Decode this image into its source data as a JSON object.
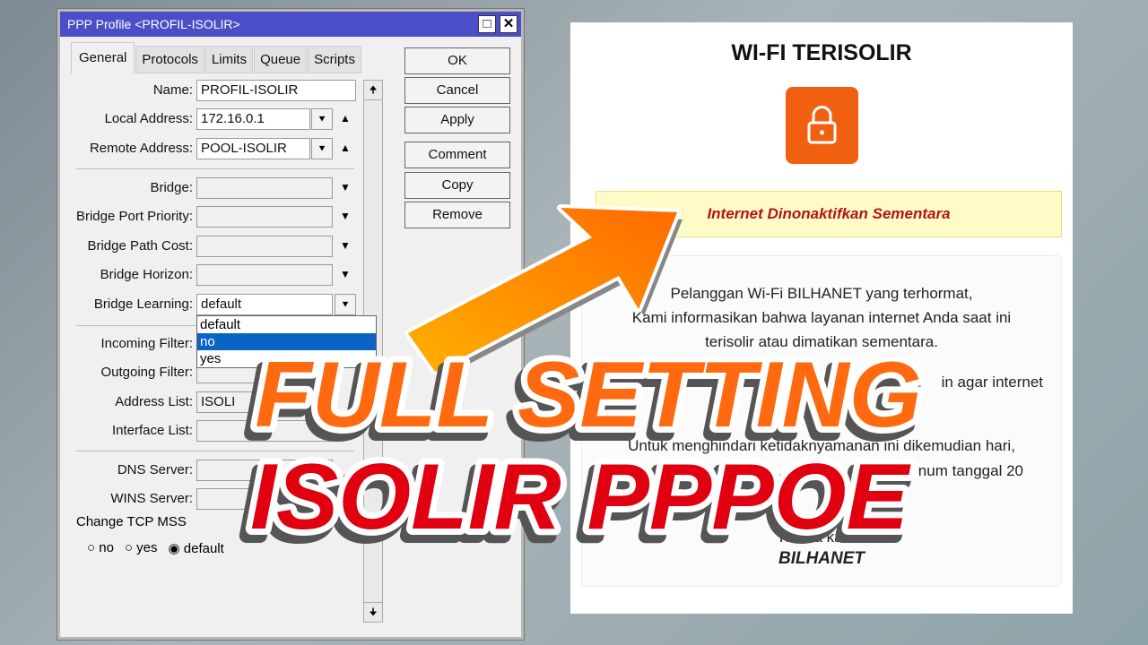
{
  "window": {
    "title": "PPP Profile <PROFIL-ISOLIR>",
    "tabs": [
      "General",
      "Protocols",
      "Limits",
      "Queue",
      "Scripts"
    ],
    "fields": {
      "name_label": "Name:",
      "name": "PROFIL-ISOLIR",
      "local_label": "Local Address:",
      "local": "172.16.0.1",
      "remote_label": "Remote Address:",
      "remote": "POOL-ISOLIR",
      "bridge": "Bridge:",
      "bpp": "Bridge Port Priority:",
      "bpc": "Bridge Path Cost:",
      "bh": "Bridge Horizon:",
      "bl_label": "Bridge Learning:",
      "bl": "default",
      "inf": "Incoming Filter:",
      "outf": "Outgoing Filter:",
      "al_label": "Address List:",
      "al": "ISOLI",
      "il": "Interface List:",
      "dns": "DNS Server:",
      "wins": "WINS Server:"
    },
    "dropdown_options": [
      "default",
      "no",
      "yes"
    ],
    "dropdown_highlighted": "no",
    "tcp_mss": {
      "label": "Change TCP MSS",
      "options": [
        "no",
        "yes",
        "default"
      ],
      "selected": "default"
    },
    "buttons": [
      "OK",
      "Cancel",
      "Apply",
      "Comment",
      "Copy",
      "Remove"
    ]
  },
  "page": {
    "title": "WI-FI TERISOLIR",
    "icon": "lock-icon",
    "banner": "Internet Dinonaktifkan Sementara",
    "lines": [
      "Pelanggan Wi-Fi BILHANET yang terhormat,",
      "Kami informasikan bahwa layanan internet Anda saat ini",
      "terisolir atau dimatikan sementara.",
      "in agar internet",
      "Untuk menghindari ketidaknyamanan ini dikemudian hari,",
      "num tanggal 20",
      "Terima kasih.",
      "BILHANET"
    ]
  },
  "overlay": {
    "line1": "FULL SETTING",
    "line2": "ISOLIR PPPOE",
    "color1": "#ff6a10",
    "color2": "#e00010"
  }
}
